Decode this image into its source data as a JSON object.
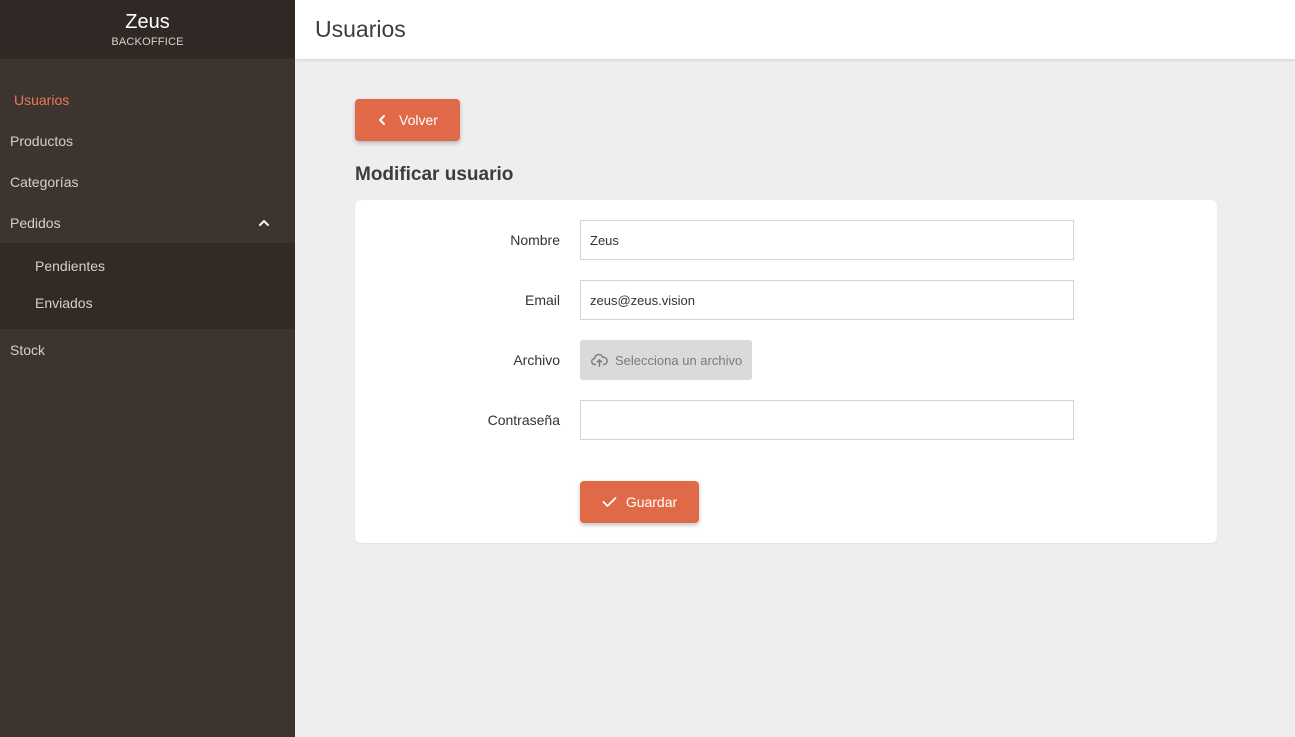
{
  "sidebar": {
    "brand_title": "Zeus",
    "brand_subtitle": "BACKOFFICE",
    "items": [
      {
        "label": "Usuarios"
      },
      {
        "label": "Productos"
      },
      {
        "label": "Categorías"
      },
      {
        "label": "Pedidos"
      }
    ],
    "pedidos_sub": [
      {
        "label": "Pendientes"
      },
      {
        "label": "Enviados"
      }
    ],
    "stock_label": "Stock"
  },
  "header": {
    "title": "Usuarios"
  },
  "main": {
    "back_label": "Volver",
    "section_title": "Modificar usuario",
    "form": {
      "nombre_label": "Nombre",
      "nombre_value": "Zeus",
      "email_label": "Email",
      "email_value": "zeus@zeus.vision",
      "archivo_label": "Archivo",
      "archivo_button": "Selecciona un archivo",
      "password_label": "Contraseña",
      "password_value": "",
      "save_label": "Guardar"
    }
  },
  "colors": {
    "accent": "#e06a47",
    "sidebar_bg": "#3e342f",
    "brand_bg": "#302824",
    "active_item": "#e8795a"
  },
  "icons": {
    "back": "chevron-left-icon",
    "collapse": "chevron-up-icon",
    "upload": "cloud-upload-icon",
    "save": "check-icon"
  }
}
